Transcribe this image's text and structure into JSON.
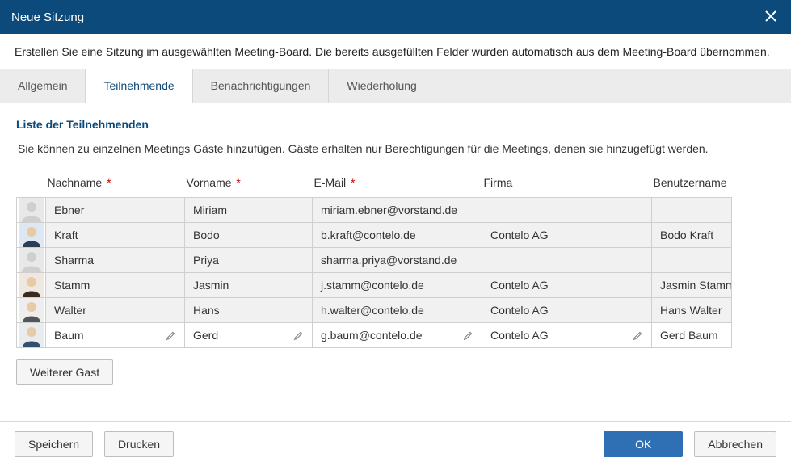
{
  "titlebar": {
    "title": "Neue Sitzung"
  },
  "intro": "Erstellen Sie eine Sitzung im ausgewählten Meeting-Board. Die bereits ausgefüllten Felder wurden automatisch aus dem Meeting-Board übernommen.",
  "tabs": [
    {
      "label": "Allgemein"
    },
    {
      "label": "Teilnehmende"
    },
    {
      "label": "Benachrichtigungen"
    },
    {
      "label": "Wiederholung"
    }
  ],
  "section": {
    "title": "Liste der Teilnehmenden",
    "desc": "Sie können zu einzelnen Meetings Gäste hinzufügen. Gäste erhalten nur Berechtigungen für die Meetings, denen sie hinzugefügt werden."
  },
  "columns": {
    "lastname": "Nachname",
    "firstname": "Vorname",
    "email": "E-Mail",
    "company": "Firma",
    "username": "Benutzername"
  },
  "rows": [
    {
      "lastname": "Ebner",
      "firstname": "Miriam",
      "email": "miriam.ebner@vorstand.de",
      "company": "",
      "username": ""
    },
    {
      "lastname": "Kraft",
      "firstname": "Bodo",
      "email": "b.kraft@contelo.de",
      "company": "Contelo AG",
      "username": "Bodo Kraft"
    },
    {
      "lastname": "Sharma",
      "firstname": "Priya",
      "email": "sharma.priya@vorstand.de",
      "company": "",
      "username": ""
    },
    {
      "lastname": "Stamm",
      "firstname": "Jasmin",
      "email": "j.stamm@contelo.de",
      "company": "Contelo AG",
      "username": "Jasmin Stamm"
    },
    {
      "lastname": "Walter",
      "firstname": "Hans",
      "email": "h.walter@contelo.de",
      "company": "Contelo AG",
      "username": "Hans Walter"
    },
    {
      "lastname": "Baum",
      "firstname": "Gerd",
      "email": "g.baum@contelo.de",
      "company": "Contelo AG",
      "username": "Gerd Baum"
    }
  ],
  "buttons": {
    "add_guest": "Weiterer Gast",
    "save": "Speichern",
    "print": "Drucken",
    "ok": "OK",
    "cancel": "Abbrechen"
  }
}
